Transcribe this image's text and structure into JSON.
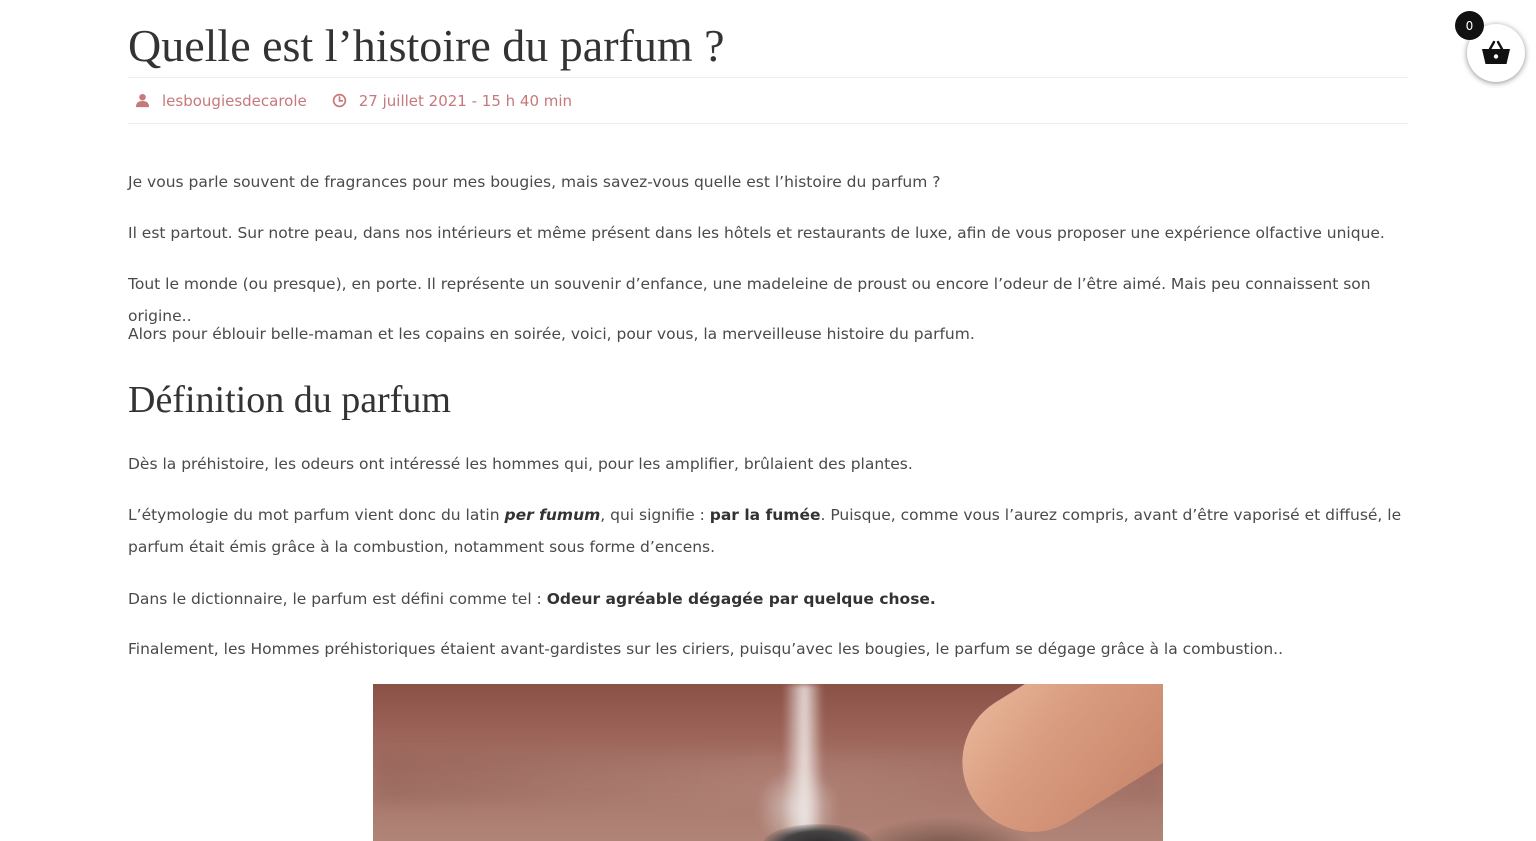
{
  "post": {
    "title": "Quelle est l’histoire du parfum ?",
    "author": "lesbougiesdecarole",
    "date": "27 juillet 2021 - 15 h 40 min"
  },
  "intro": [
    "Je vous parle souvent de fragrances pour mes bougies, mais savez-vous quelle est l’histoire du parfum ?",
    "Il est partout. Sur notre peau, dans nos intérieurs et même présent dans les hôtels et restaurants de luxe, afin de vous proposer une expérience olfactive unique.",
    "Tout le monde (ou presque), en porte. Il représente un souvenir d’enfance, une madeleine de proust ou encore l’odeur de l’être aimé. Mais peu connaissent son origine..",
    "Alors pour éblouir belle-maman et les copains en soirée, voici, pour vous, la merveilleuse histoire du parfum."
  ],
  "section": {
    "title": "Définition du parfum",
    "p1": "Dès la préhistoire, les odeurs ont intéressé les hommes qui, pour les amplifier, brûlaient des plantes.",
    "p2_before": "L’étymologie du mot parfum vient donc du latin ",
    "p2_latin": "per fumum",
    "p2_middle": ", qui signifie : ",
    "p2_meaning": "par la fumée",
    "p2_after": ". Puisque, comme vous l’aurez compris, avant d’être vaporisé et diffusé, le parfum était émis grâce à la combustion, notamment sous forme d’encens.",
    "p3_before": "Dans le dictionnaire, le parfum est défini comme tel : ",
    "p3_bold": "Odeur agréable dégagée par quelque chose.",
    "p4": "Finalement, les Hommes préhistoriques étaient avant-gardistes sur les ciriers, puisqu’avec les bougies, le parfum se dégage grâce à la combustion.."
  },
  "cart": {
    "count": "0",
    "icon": "basket-icon"
  },
  "colors": {
    "meta_accent": "#c7787b",
    "text": "#4a4a4a",
    "heading": "#333333",
    "cart_badge": "#111111"
  }
}
